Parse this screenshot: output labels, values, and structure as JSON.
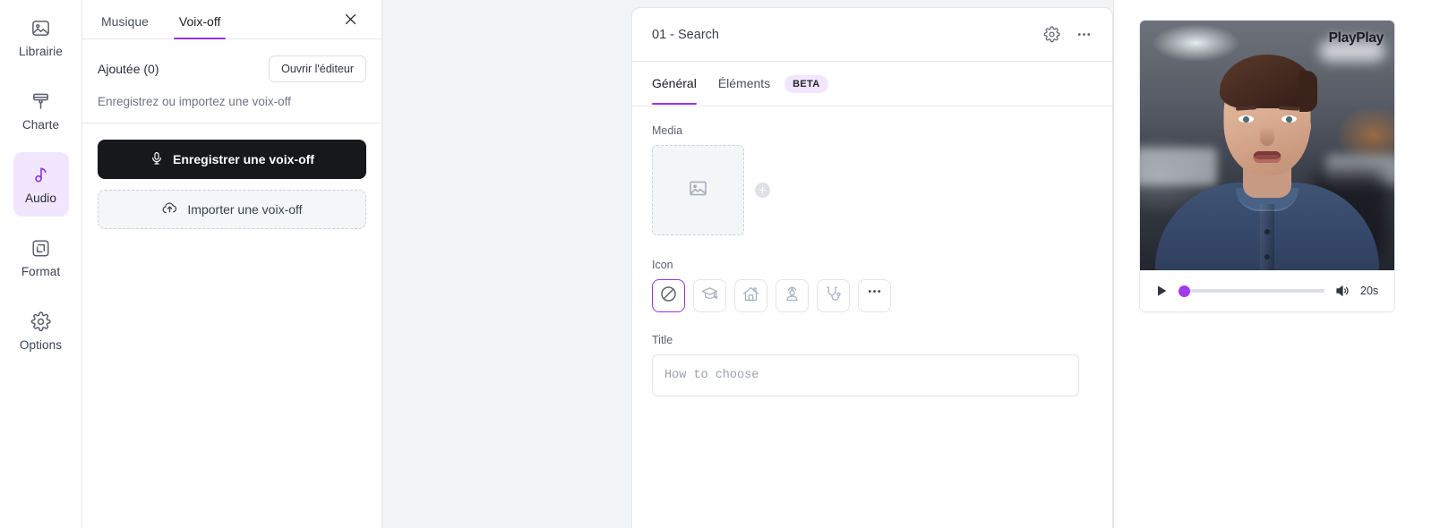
{
  "colors": {
    "accent": "#9333ea",
    "accent_soft": "#f1e6fe",
    "bg": "#f2f3f5",
    "panel": "#ffffff",
    "border": "#e4e6ea",
    "scrub_thumb": "#a23bec",
    "record_btn_bg": "#17181c"
  },
  "sidebar": {
    "items": [
      {
        "label": "Librairie",
        "icon": "image-library-icon",
        "active": false
      },
      {
        "label": "Charte",
        "icon": "paint-brush-icon",
        "active": false
      },
      {
        "label": "Audio",
        "icon": "music-note-icon",
        "active": true
      },
      {
        "label": "Format",
        "icon": "resize-frame-icon",
        "active": false
      },
      {
        "label": "Options",
        "icon": "gear-icon",
        "active": false
      }
    ]
  },
  "audio_panel": {
    "tabs": [
      {
        "label": "Musique",
        "active": false
      },
      {
        "label": "Voix-off",
        "active": true
      }
    ],
    "close_icon": "close-icon",
    "added_label": "Ajoutée (0)",
    "open_editor_label": "Ouvrir l'éditeur",
    "hint": "Enregistrez ou importez une voix-off",
    "record_label": "Enregistrer une voix-off",
    "record_icon": "microphone-icon",
    "import_label": "Importer une voix-off",
    "import_icon": "cloud-upload-icon"
  },
  "edit_card": {
    "title": "01 - Search",
    "settings_icon": "gear-icon",
    "more_icon": "more-horizontal-icon",
    "tabs": [
      {
        "label": "Général",
        "active": true
      },
      {
        "label": "Éléments",
        "active": false
      }
    ],
    "beta_badge": "BETA",
    "media": {
      "label": "Media",
      "placeholder_icon": "image-placeholder-icon",
      "add_label": "+"
    },
    "icon_field": {
      "label": "Icon",
      "options": [
        {
          "name": "prohibited-icon",
          "selected": true
        },
        {
          "name": "graduation-cap-icon",
          "selected": false
        },
        {
          "name": "house-icon",
          "selected": false
        },
        {
          "name": "nurse-icon",
          "selected": false
        },
        {
          "name": "stethoscope-icon",
          "selected": false
        },
        {
          "name": "more-icon",
          "selected": false,
          "label": "•••"
        }
      ]
    },
    "title_field": {
      "label": "Title",
      "value": "",
      "placeholder": "How to choose"
    }
  },
  "preview": {
    "logo": "PlayPlay",
    "play_icon": "play-icon",
    "volume_icon": "volume-on-icon",
    "duration": "20s",
    "progress_percent": 0
  }
}
